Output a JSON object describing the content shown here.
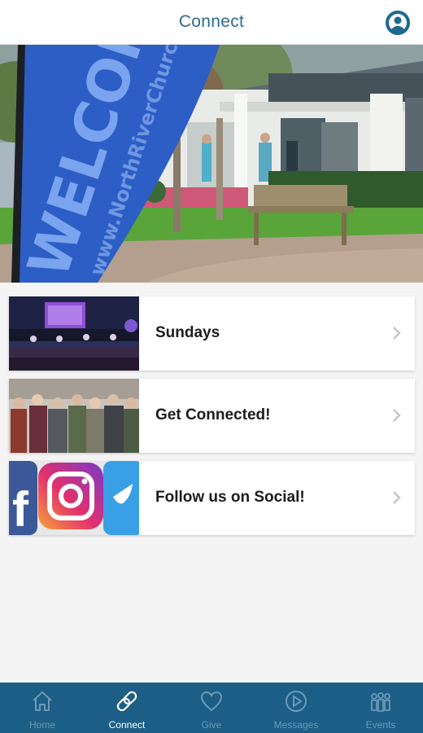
{
  "header": {
    "title": "Connect",
    "profile_icon": "user-circle-icon"
  },
  "hero": {
    "banner_text": "WELCOME",
    "banner_url": "www.NorthRiverChurch",
    "alt_subject": "church entrance with welcome flag, garden and bench"
  },
  "list": {
    "items": [
      {
        "label": "Sundays",
        "thumb": "worship-stage-photo",
        "chevron": "chevron-right-icon"
      },
      {
        "label": "Get Connected!",
        "thumb": "group-photo",
        "chevron": "chevron-right-icon"
      },
      {
        "label": "Follow us on Social!",
        "thumb": "social-logos-photo",
        "chevron": "chevron-right-icon"
      }
    ]
  },
  "tabbar": {
    "active": "Connect",
    "tabs": [
      {
        "label": "Home",
        "icon": "home-icon"
      },
      {
        "label": "Connect",
        "icon": "link-icon"
      },
      {
        "label": "Give",
        "icon": "heart-icon"
      },
      {
        "label": "Messages",
        "icon": "play-circle-icon"
      },
      {
        "label": "Events",
        "icon": "people-icon"
      }
    ]
  },
  "colors": {
    "accent": "#1c5e85",
    "title": "#2d6b8f",
    "tab_inactive": "#6b9ab8",
    "tab_active": "#ffffff",
    "background": "#f4f4f4"
  }
}
